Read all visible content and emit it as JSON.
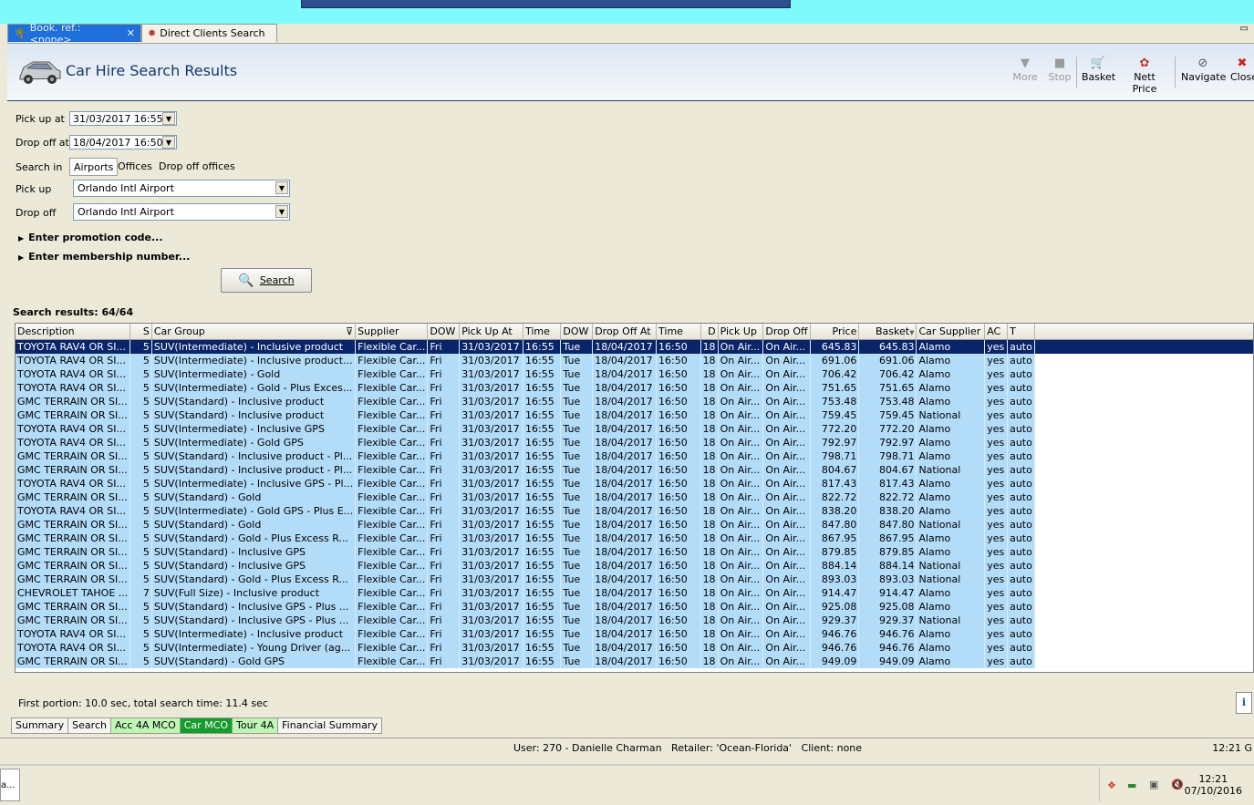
{
  "tabs": [
    {
      "label": "Book. ref.: <none>",
      "active": true
    },
    {
      "label": "Direct Clients Search",
      "active": false
    }
  ],
  "header": {
    "title": "Car Hire Search Results",
    "toolbar": {
      "more": "More",
      "stop": "Stop",
      "basket": "Basket",
      "nett_price": "Nett Price",
      "navigate": "Navigate",
      "close": "Close"
    }
  },
  "form": {
    "pickup_at_label": "Pick up at",
    "pickup_at_value": "31/03/2017 16:55",
    "dropoff_at_label": "Drop off at",
    "dropoff_at_value": "18/04/2017 16:50",
    "search_in_label": "Search in",
    "search_in_options": [
      "Airports",
      "Offices",
      "Drop off offices"
    ],
    "pickup_label": "Pick up",
    "pickup_value": "Orlando Intl Airport",
    "dropoff_label": "Drop off",
    "dropoff_value": "Orlando Intl Airport",
    "promo_label": "Enter promotion code...",
    "membership_label": "Enter membership number...",
    "search_button": "Search"
  },
  "results": {
    "count_label": "Search results: 64/64",
    "columns": [
      "Description",
      "S",
      "Car Group",
      "Supplier",
      "DOW",
      "Pick Up At",
      "Time",
      "DOW",
      "Drop Off At",
      "Time",
      "D",
      "Pick Up",
      "Drop Off",
      "Price",
      "Basket",
      "Car Supplier",
      "AC",
      "T"
    ],
    "rows": [
      [
        "TOYOTA RAV4 OR SI...",
        "5",
        "SUV(Intermediate) - Inclusive product",
        "Flexible Car...",
        "Fri",
        "31/03/2017",
        "16:55",
        "Tue",
        "18/04/2017",
        "16:50",
        "18",
        "On Air...",
        "On Air...",
        "645.83",
        "645.83",
        "Alamo",
        "yes",
        "auto"
      ],
      [
        "TOYOTA RAV4 OR SI...",
        "5",
        "SUV(Intermediate) - Inclusive product...",
        "Flexible Car...",
        "Fri",
        "31/03/2017",
        "16:55",
        "Tue",
        "18/04/2017",
        "16:50",
        "18",
        "On Air...",
        "On Air...",
        "691.06",
        "691.06",
        "Alamo",
        "yes",
        "auto"
      ],
      [
        "TOYOTA RAV4 OR SI...",
        "5",
        "SUV(Intermediate) - Gold",
        "Flexible Car...",
        "Fri",
        "31/03/2017",
        "16:55",
        "Tue",
        "18/04/2017",
        "16:50",
        "18",
        "On Air...",
        "On Air...",
        "706.42",
        "706.42",
        "Alamo",
        "yes",
        "auto"
      ],
      [
        "TOYOTA RAV4 OR SI...",
        "5",
        "SUV(Intermediate) - Gold - Plus Exces...",
        "Flexible Car...",
        "Fri",
        "31/03/2017",
        "16:55",
        "Tue",
        "18/04/2017",
        "16:50",
        "18",
        "On Air...",
        "On Air...",
        "751.65",
        "751.65",
        "Alamo",
        "yes",
        "auto"
      ],
      [
        "GMC TERRAIN OR SI...",
        "5",
        "SUV(Standard) - Inclusive product",
        "Flexible Car...",
        "Fri",
        "31/03/2017",
        "16:55",
        "Tue",
        "18/04/2017",
        "16:50",
        "18",
        "On Air...",
        "On Air...",
        "753.48",
        "753.48",
        "Alamo",
        "yes",
        "auto"
      ],
      [
        "GMC TERRAIN OR SI...",
        "5",
        "SUV(Standard) - Inclusive product",
        "Flexible Car...",
        "Fri",
        "31/03/2017",
        "16:55",
        "Tue",
        "18/04/2017",
        "16:50",
        "18",
        "On Air...",
        "On Air...",
        "759.45",
        "759.45",
        "National",
        "yes",
        "auto"
      ],
      [
        "TOYOTA RAV4 OR SI...",
        "5",
        "SUV(Intermediate) - Inclusive GPS",
        "Flexible Car...",
        "Fri",
        "31/03/2017",
        "16:55",
        "Tue",
        "18/04/2017",
        "16:50",
        "18",
        "On Air...",
        "On Air...",
        "772.20",
        "772.20",
        "Alamo",
        "yes",
        "auto"
      ],
      [
        "TOYOTA RAV4 OR SI...",
        "5",
        "SUV(Intermediate) - Gold GPS",
        "Flexible Car...",
        "Fri",
        "31/03/2017",
        "16:55",
        "Tue",
        "18/04/2017",
        "16:50",
        "18",
        "On Air...",
        "On Air...",
        "792.97",
        "792.97",
        "Alamo",
        "yes",
        "auto"
      ],
      [
        "GMC TERRAIN OR SI...",
        "5",
        "SUV(Standard) - Inclusive product - Pl...",
        "Flexible Car...",
        "Fri",
        "31/03/2017",
        "16:55",
        "Tue",
        "18/04/2017",
        "16:50",
        "18",
        "On Air...",
        "On Air...",
        "798.71",
        "798.71",
        "Alamo",
        "yes",
        "auto"
      ],
      [
        "GMC TERRAIN OR SI...",
        "5",
        "SUV(Standard) - Inclusive product - Pl...",
        "Flexible Car...",
        "Fri",
        "31/03/2017",
        "16:55",
        "Tue",
        "18/04/2017",
        "16:50",
        "18",
        "On Air...",
        "On Air...",
        "804.67",
        "804.67",
        "National",
        "yes",
        "auto"
      ],
      [
        "TOYOTA RAV4 OR SI...",
        "5",
        "SUV(Intermediate) - Inclusive GPS - Pl...",
        "Flexible Car...",
        "Fri",
        "31/03/2017",
        "16:55",
        "Tue",
        "18/04/2017",
        "16:50",
        "18",
        "On Air...",
        "On Air...",
        "817.43",
        "817.43",
        "Alamo",
        "yes",
        "auto"
      ],
      [
        "GMC TERRAIN OR SI...",
        "5",
        "SUV(Standard) - Gold",
        "Flexible Car...",
        "Fri",
        "31/03/2017",
        "16:55",
        "Tue",
        "18/04/2017",
        "16:50",
        "18",
        "On Air...",
        "On Air...",
        "822.72",
        "822.72",
        "Alamo",
        "yes",
        "auto"
      ],
      [
        "TOYOTA RAV4 OR SI...",
        "5",
        "SUV(Intermediate) - Gold GPS - Plus E...",
        "Flexible Car...",
        "Fri",
        "31/03/2017",
        "16:55",
        "Tue",
        "18/04/2017",
        "16:50",
        "18",
        "On Air...",
        "On Air...",
        "838.20",
        "838.20",
        "Alamo",
        "yes",
        "auto"
      ],
      [
        "GMC TERRAIN OR SI...",
        "5",
        "SUV(Standard) - Gold",
        "Flexible Car...",
        "Fri",
        "31/03/2017",
        "16:55",
        "Tue",
        "18/04/2017",
        "16:50",
        "18",
        "On Air...",
        "On Air...",
        "847.80",
        "847.80",
        "National",
        "yes",
        "auto"
      ],
      [
        "GMC TERRAIN OR SI...",
        "5",
        "SUV(Standard) - Gold - Plus Excess R...",
        "Flexible Car...",
        "Fri",
        "31/03/2017",
        "16:55",
        "Tue",
        "18/04/2017",
        "16:50",
        "18",
        "On Air...",
        "On Air...",
        "867.95",
        "867.95",
        "Alamo",
        "yes",
        "auto"
      ],
      [
        "GMC TERRAIN OR SI...",
        "5",
        "SUV(Standard) - Inclusive GPS",
        "Flexible Car...",
        "Fri",
        "31/03/2017",
        "16:55",
        "Tue",
        "18/04/2017",
        "16:50",
        "18",
        "On Air...",
        "On Air...",
        "879.85",
        "879.85",
        "Alamo",
        "yes",
        "auto"
      ],
      [
        "GMC TERRAIN OR SI...",
        "5",
        "SUV(Standard) - Inclusive GPS",
        "Flexible Car...",
        "Fri",
        "31/03/2017",
        "16:55",
        "Tue",
        "18/04/2017",
        "16:50",
        "18",
        "On Air...",
        "On Air...",
        "884.14",
        "884.14",
        "National",
        "yes",
        "auto"
      ],
      [
        "GMC TERRAIN OR SI...",
        "5",
        "SUV(Standard) - Gold - Plus Excess R...",
        "Flexible Car...",
        "Fri",
        "31/03/2017",
        "16:55",
        "Tue",
        "18/04/2017",
        "16:50",
        "18",
        "On Air...",
        "On Air...",
        "893.03",
        "893.03",
        "National",
        "yes",
        "auto"
      ],
      [
        "CHEVROLET TAHOE ...",
        "7",
        "SUV(Full Size) - Inclusive product",
        "Flexible Car...",
        "Fri",
        "31/03/2017",
        "16:55",
        "Tue",
        "18/04/2017",
        "16:50",
        "18",
        "On Air...",
        "On Air...",
        "914.47",
        "914.47",
        "Alamo",
        "yes",
        "auto"
      ],
      [
        "GMC TERRAIN OR SI...",
        "5",
        "SUV(Standard) - Inclusive GPS - Plus ...",
        "Flexible Car...",
        "Fri",
        "31/03/2017",
        "16:55",
        "Tue",
        "18/04/2017",
        "16:50",
        "18",
        "On Air...",
        "On Air...",
        "925.08",
        "925.08",
        "Alamo",
        "yes",
        "auto"
      ],
      [
        "GMC TERRAIN OR SI...",
        "5",
        "SUV(Standard) - Inclusive GPS - Plus ...",
        "Flexible Car...",
        "Fri",
        "31/03/2017",
        "16:55",
        "Tue",
        "18/04/2017",
        "16:50",
        "18",
        "On Air...",
        "On Air...",
        "929.37",
        "929.37",
        "National",
        "yes",
        "auto"
      ],
      [
        "TOYOTA RAV4 OR SI...",
        "5",
        "SUV(Intermediate) - Inclusive product",
        "Flexible Car...",
        "Fri",
        "31/03/2017",
        "16:55",
        "Tue",
        "18/04/2017",
        "16:50",
        "18",
        "On Air...",
        "On Air...",
        "946.76",
        "946.76",
        "Alamo",
        "yes",
        "auto"
      ],
      [
        "TOYOTA RAV4 OR SI...",
        "5",
        "SUV(Intermediate) - Young Driver (ag...",
        "Flexible Car...",
        "Fri",
        "31/03/2017",
        "16:55",
        "Tue",
        "18/04/2017",
        "16:50",
        "18",
        "On Air...",
        "On Air...",
        "946.76",
        "946.76",
        "Alamo",
        "yes",
        "auto"
      ],
      [
        "GMC TERRAIN OR SI...",
        "5",
        "SUV(Standard) - Gold GPS",
        "Flexible Car...",
        "Fri",
        "31/03/2017",
        "16:55",
        "Tue",
        "18/04/2017",
        "16:50",
        "18",
        "On Air...",
        "On Air...",
        "949.09",
        "949.09",
        "Alamo",
        "yes",
        "auto"
      ]
    ]
  },
  "status_line": "First portion: 10.0 sec, total search time: 11.4 sec",
  "bottom_tabs": [
    "Summary",
    "Search",
    "Acc 4A MCO",
    "Car MCO",
    "Tour 4A",
    "Financial Summary"
  ],
  "statusbar": {
    "user": "User: 270 - Danielle Charman   Retailer: 'Ocean-Florida'   Client: none",
    "time": "12:21 G"
  },
  "taskbar": {
    "item": "a...",
    "clock_time": "12:21",
    "clock_date": "07/10/2016"
  },
  "colors": {
    "row_bg": "#b3dcf9",
    "selected_row_bg": "#0a246a",
    "title_color": "#17376b",
    "tab_active": "#1e6fd9"
  }
}
